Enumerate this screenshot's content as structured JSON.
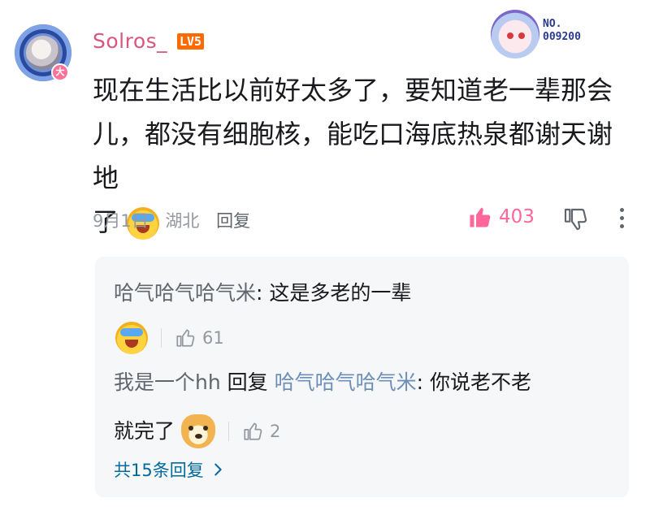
{
  "comment": {
    "username": "Solros_",
    "level": "LV5",
    "avatar_badge": "大",
    "medal_label_line1": "NO.",
    "medal_label_line2": "009200",
    "text_line1": "现在生活比以前好太多了，要知道老一辈那会",
    "text_line2": "儿，都没有细胞核，能吃口海底热泉都谢天谢地",
    "text_line3": "了",
    "date": "9月1日",
    "location": "湖北",
    "reply_label": "回复",
    "like_count": "403",
    "accent_color": "#ff6699",
    "username_color": "#d9567e"
  },
  "replies": [
    {
      "name": "哈气哈气哈气米",
      "text": ": 这是多老的一辈",
      "emoji": "laugh-cover-face-emoji",
      "like_count": "61"
    },
    {
      "name": "我是一个hh",
      "reply_word": " 回复 ",
      "target": "哈气哈气哈气米",
      "text": ": 你说老不老",
      "text_cont": "就完了",
      "emoji": "doge-emoji",
      "like_count": "2"
    }
  ],
  "total_replies": "共15条回复"
}
